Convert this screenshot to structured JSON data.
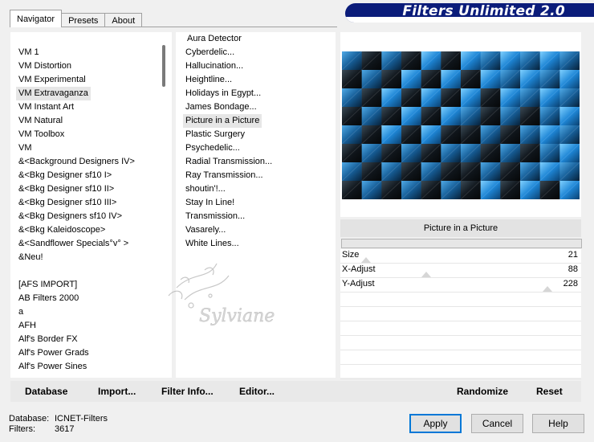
{
  "tabs": {
    "navigator": "Navigator",
    "presets": "Presets",
    "about": "About"
  },
  "banner": {
    "title": "Filters Unlimited 2.0"
  },
  "categories": [
    {
      "label": "VM 1",
      "selected": false
    },
    {
      "label": "VM Distortion",
      "selected": false
    },
    {
      "label": "VM Experimental",
      "selected": false
    },
    {
      "label": "VM Extravaganza",
      "selected": true
    },
    {
      "label": "VM Instant Art",
      "selected": false
    },
    {
      "label": "VM Natural",
      "selected": false
    },
    {
      "label": "VM Toolbox",
      "selected": false
    },
    {
      "label": "VM",
      "selected": false
    },
    {
      "label": "&<Background Designers IV>",
      "selected": false
    },
    {
      "label": "&<Bkg Designer sf10 I>",
      "selected": false
    },
    {
      "label": "&<Bkg Designer sf10 II>",
      "selected": false
    },
    {
      "label": "&<Bkg Designer sf10 III>",
      "selected": false
    },
    {
      "label": "&<Bkg Designers sf10 IV>",
      "selected": false
    },
    {
      "label": "&<Bkg Kaleidoscope>",
      "selected": false
    },
    {
      "label": "&<Sandflower Specials°v° >",
      "selected": false
    },
    {
      "label": "&Neu!",
      "selected": false
    },
    {
      "label": "",
      "selected": false
    },
    {
      "label": "[AFS IMPORT]",
      "selected": false
    },
    {
      "label": "AB Filters 2000",
      "selected": false
    },
    {
      "label": "a",
      "selected": false
    },
    {
      "label": "AFH",
      "selected": false
    },
    {
      "label": "Alf's Border FX",
      "selected": false
    },
    {
      "label": "Alf's Power Grads",
      "selected": false
    },
    {
      "label": "Alf's Power Sines",
      "selected": false
    }
  ],
  "filters": [
    {
      "label": "Aura Detector",
      "selected": false
    },
    {
      "label": "Cyberdelic...",
      "selected": false
    },
    {
      "label": "Hallucination...",
      "selected": false
    },
    {
      "label": "Heightline...",
      "selected": false
    },
    {
      "label": "Holidays in Egypt...",
      "selected": false
    },
    {
      "label": "James Bondage...",
      "selected": false
    },
    {
      "label": "Picture in a Picture",
      "selected": true
    },
    {
      "label": "Plastic Surgery",
      "selected": false
    },
    {
      "label": "Psychedelic...",
      "selected": false
    },
    {
      "label": "Radial Transmission...",
      "selected": false
    },
    {
      "label": "Ray Transmission...",
      "selected": false
    },
    {
      "label": "shoutin'!...",
      "selected": false
    },
    {
      "label": "Stay In Line!",
      "selected": false
    },
    {
      "label": "Transmission...",
      "selected": false
    },
    {
      "label": "Vasarely...",
      "selected": false
    },
    {
      "label": "White Lines...",
      "selected": false
    }
  ],
  "preview": {
    "filter_name": "Picture in a Picture"
  },
  "params": [
    {
      "name": "Size",
      "value": "21",
      "level": 0.08
    },
    {
      "name": "X-Adjust",
      "value": "88",
      "level": 0.35
    },
    {
      "name": "Y-Adjust",
      "value": "228",
      "level": 0.9
    }
  ],
  "toolbar": {
    "database": "Database",
    "import": "Import...",
    "filter_info": "Filter Info...",
    "editor": "Editor...",
    "randomize": "Randomize",
    "reset": "Reset"
  },
  "status": {
    "database_label": "Database:",
    "database_value": "ICNET-Filters",
    "filters_label": "Filters:",
    "filters_value": "3617"
  },
  "buttons": {
    "apply": "Apply",
    "cancel": "Cancel",
    "help": "Help"
  },
  "watermark": {
    "text": "Sylviane"
  },
  "colors": {
    "banner": "#0b1c7a",
    "preview_blue": "#2a8fd6",
    "preview_dark": "#0d1a24"
  }
}
